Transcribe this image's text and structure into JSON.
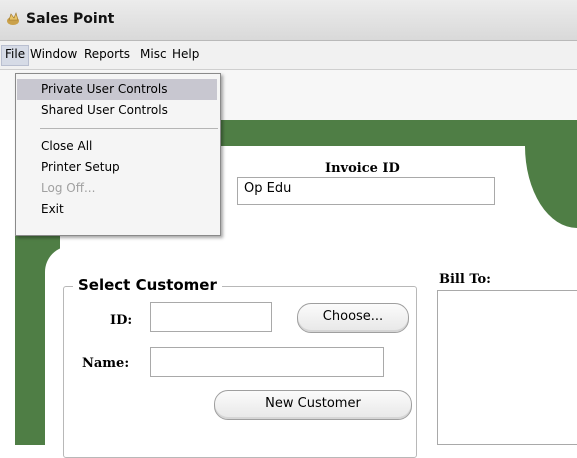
{
  "app": {
    "title": "Sales Point",
    "icon": "sales-point-app-icon"
  },
  "menubar": {
    "items": [
      "File",
      "Window",
      "Reports",
      "Misc",
      "Help"
    ],
    "active": "File"
  },
  "file_menu": {
    "items": [
      {
        "label": "Private User Controls",
        "highlighted": true,
        "disabled": false
      },
      {
        "label": "Shared User Controls",
        "highlighted": false,
        "disabled": false
      },
      {
        "label": "Close All",
        "highlighted": false,
        "disabled": false
      },
      {
        "label": "Printer Setup",
        "highlighted": false,
        "disabled": false
      },
      {
        "label": "Log Off...",
        "highlighted": false,
        "disabled": true
      },
      {
        "label": "Exit",
        "highlighted": false,
        "disabled": false
      }
    ]
  },
  "invoice": {
    "label": "Invoice ID",
    "value": "Op Edu"
  },
  "customer": {
    "group_title": "Select Customer",
    "id_label": "ID:",
    "id_value": "",
    "choose_label": "Choose...",
    "name_label": "Name:",
    "name_value": "",
    "new_customer_label": "New Customer"
  },
  "bill_to": {
    "label": "Bill To:",
    "value": ""
  },
  "colors": {
    "background_green": "#4f7e45",
    "menu_highlight": "#c8c7d0"
  }
}
